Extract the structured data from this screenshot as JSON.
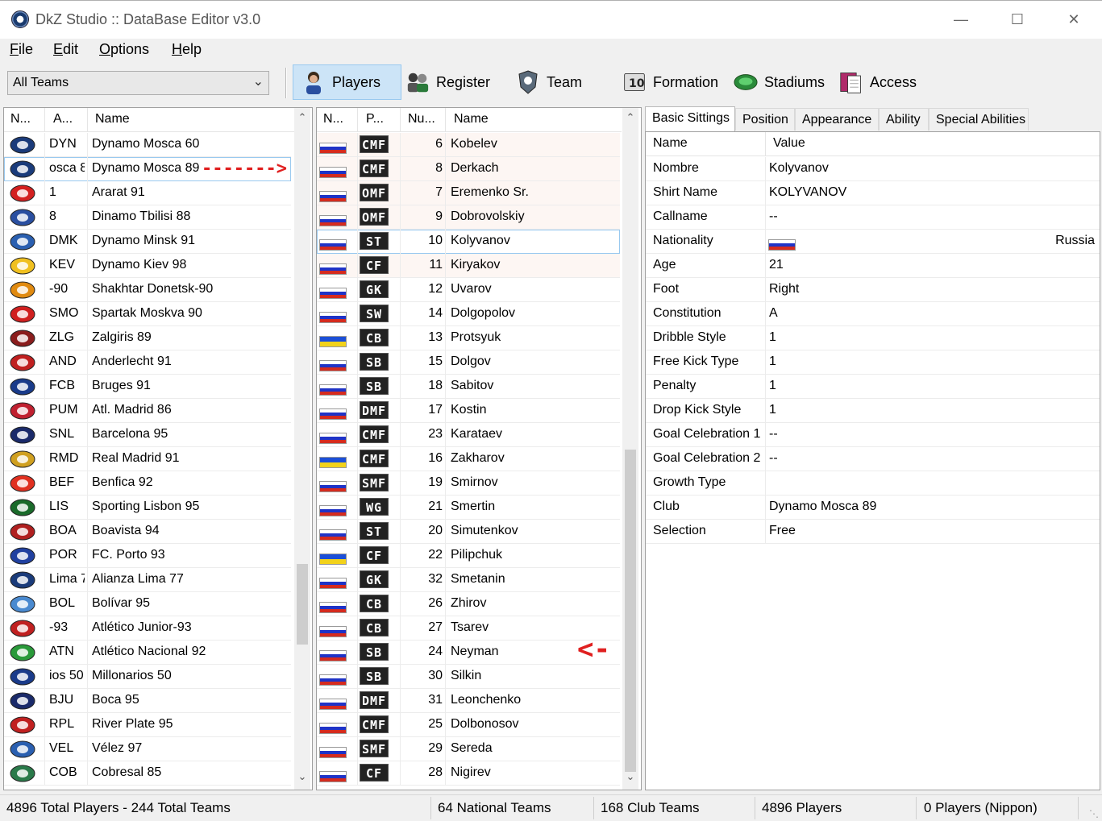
{
  "window": {
    "title": "DkZ Studio :: DataBase Editor v3.0",
    "minimize": "—",
    "maximize": "☐",
    "close": "✕"
  },
  "menu": [
    {
      "key": "F",
      "rest": "ile"
    },
    {
      "key": "E",
      "rest": "dit"
    },
    {
      "key": "O",
      "rest": "ptions"
    },
    {
      "key": "H",
      "rest": "elp"
    }
  ],
  "toolbar": {
    "team_filter": "All Teams",
    "buttons": [
      {
        "label": "Players",
        "icon": "player-icon",
        "active": true
      },
      {
        "label": "Register",
        "icon": "register-icon"
      },
      {
        "label": "Team",
        "icon": "team-icon"
      },
      {
        "label": "Formation",
        "icon": "formation-icon"
      },
      {
        "label": "Stadiums",
        "icon": "stadium-icon"
      },
      {
        "label": "Access",
        "icon": "access-icon"
      }
    ]
  },
  "teams": {
    "headers": [
      "N...",
      "A...",
      "Name"
    ],
    "selected_index": 1,
    "rows": [
      {
        "abbr": "DYN",
        "name": "Dynamo Mosca 60",
        "logo": "#1a3b7a"
      },
      {
        "abbr": "osca 8",
        "name": "Dynamo Mosca 89",
        "logo": "#1a3b7a"
      },
      {
        "abbr": "1",
        "name": "Ararat 91",
        "logo": "#d32020"
      },
      {
        "abbr": "8",
        "name": "Dinamo Tbilisi 88",
        "logo": "#2a4fa0"
      },
      {
        "abbr": "DMK",
        "name": "Dynamo Minsk 91",
        "logo": "#2a5fb0"
      },
      {
        "abbr": "KEV",
        "name": "Dynamo Kiev 98",
        "logo": "#f0c020"
      },
      {
        "abbr": "-90",
        "name": "Shakhtar Donetsk-90",
        "logo": "#e08a10"
      },
      {
        "abbr": "SMO",
        "name": "Spartak Moskva 90",
        "logo": "#d02020"
      },
      {
        "abbr": "ZLG",
        "name": "Zalgiris 89",
        "logo": "#8a1d1d"
      },
      {
        "abbr": "AND",
        "name": "Anderlecht 91",
        "logo": "#c02020"
      },
      {
        "abbr": "FCB",
        "name": "Bruges 91",
        "logo": "#1a3b8a"
      },
      {
        "abbr": "PUM",
        "name": "Atl. Madrid 86",
        "logo": "#c02030"
      },
      {
        "abbr": "SNL",
        "name": "Barcelona 95",
        "logo": "#1a2a6a"
      },
      {
        "abbr": "RMD",
        "name": "Real Madrid 91",
        "logo": "#d0a020"
      },
      {
        "abbr": "BEF",
        "name": "Benfica 92",
        "logo": "#e03020"
      },
      {
        "abbr": "LIS",
        "name": "Sporting Lisbon 95",
        "logo": "#1a6a2a"
      },
      {
        "abbr": "BOA",
        "name": "Boavista 94",
        "logo": "#b02020"
      },
      {
        "abbr": "POR",
        "name": "FC. Porto 93",
        "logo": "#2040a0"
      },
      {
        "abbr": "Lima 7",
        "name": "Alianza Lima 77",
        "logo": "#1a3b7a"
      },
      {
        "abbr": "BOL",
        "name": "Bolívar 95",
        "logo": "#4a8ad0"
      },
      {
        "abbr": "-93",
        "name": "Atlético Junior-93",
        "logo": "#c02020"
      },
      {
        "abbr": "ATN",
        "name": "Atlético Nacional 92",
        "logo": "#2a9a3a"
      },
      {
        "abbr": "ios 50",
        "name": "Millonarios 50",
        "logo": "#1a3b8a"
      },
      {
        "abbr": "BJU",
        "name": "Boca 95",
        "logo": "#1a2a6a"
      },
      {
        "abbr": "RPL",
        "name": "River Plate 95",
        "logo": "#c02020"
      },
      {
        "abbr": "VEL",
        "name": "Vélez 97",
        "logo": "#2a5fb0"
      },
      {
        "abbr": "COB",
        "name": "Cobresal 85",
        "logo": "#2a7a4a"
      }
    ]
  },
  "players": {
    "headers": [
      "N...",
      "P...",
      "Nu...",
      "Name"
    ],
    "selected_index": 4,
    "rows": [
      {
        "flag": "ru",
        "pos": "CMF",
        "num": "6",
        "name": "Kobelev"
      },
      {
        "flag": "ru",
        "pos": "CMF",
        "num": "8",
        "name": "Derkach"
      },
      {
        "flag": "ru",
        "pos": "OMF",
        "num": "7",
        "name": "Eremenko Sr."
      },
      {
        "flag": "ru",
        "pos": "OMF",
        "num": "9",
        "name": "Dobrovolskiy"
      },
      {
        "flag": "ru",
        "pos": "ST",
        "num": "10",
        "name": "Kolyvanov"
      },
      {
        "flag": "ru",
        "pos": "CF",
        "num": "11",
        "name": "Kiryakov"
      },
      {
        "flag": "ru",
        "pos": "GK",
        "num": "12",
        "name": "Uvarov"
      },
      {
        "flag": "ru",
        "pos": "SW",
        "num": "14",
        "name": "Dolgopolov"
      },
      {
        "flag": "ua",
        "pos": "CB",
        "num": "13",
        "name": "Protsyuk"
      },
      {
        "flag": "ru",
        "pos": "SB",
        "num": "15",
        "name": "Dolgov"
      },
      {
        "flag": "ru",
        "pos": "SB",
        "num": "18",
        "name": "Sabitov"
      },
      {
        "flag": "ru",
        "pos": "DMF",
        "num": "17",
        "name": "Kostin"
      },
      {
        "flag": "ru",
        "pos": "CMF",
        "num": "23",
        "name": "Karataev"
      },
      {
        "flag": "ua",
        "pos": "CMF",
        "num": "16",
        "name": "Zakharov"
      },
      {
        "flag": "ru",
        "pos": "SMF",
        "num": "19",
        "name": "Smirnov"
      },
      {
        "flag": "ru",
        "pos": "WG",
        "num": "21",
        "name": "Smertin"
      },
      {
        "flag": "ru",
        "pos": "ST",
        "num": "20",
        "name": "Simutenkov"
      },
      {
        "flag": "ua",
        "pos": "CF",
        "num": "22",
        "name": "Pilipchuk"
      },
      {
        "flag": "ru",
        "pos": "GK",
        "num": "32",
        "name": "Smetanin"
      },
      {
        "flag": "ru",
        "pos": "CB",
        "num": "26",
        "name": "Zhirov"
      },
      {
        "flag": "ru",
        "pos": "CB",
        "num": "27",
        "name": "Tsarev"
      },
      {
        "flag": "ru",
        "pos": "SB",
        "num": "24",
        "name": "Neyman"
      },
      {
        "flag": "ru",
        "pos": "SB",
        "num": "30",
        "name": "Silkin"
      },
      {
        "flag": "ru",
        "pos": "DMF",
        "num": "31",
        "name": "Leonchenko"
      },
      {
        "flag": "ru",
        "pos": "CMF",
        "num": "25",
        "name": "Dolbonosov"
      },
      {
        "flag": "ru",
        "pos": "SMF",
        "num": "29",
        "name": "Sereda"
      },
      {
        "flag": "ru",
        "pos": "CF",
        "num": "28",
        "name": "Nigirev"
      }
    ]
  },
  "details": {
    "tabs": [
      "Basic Sittings",
      "Position",
      "Appearance",
      "Ability",
      "Special Abilities"
    ],
    "active_tab": 0,
    "headers": [
      "Name",
      "Value"
    ],
    "rows": [
      {
        "label": "Nombre",
        "value": "Kolyvanov"
      },
      {
        "label": "Shirt Name",
        "value": "KOLYVANOV"
      },
      {
        "label": "Callname",
        "value": "--"
      },
      {
        "label": "Nationality",
        "value": "",
        "flag": "ru",
        "extra": "Russia"
      },
      {
        "label": "Age",
        "value": "21"
      },
      {
        "label": "Foot",
        "value": "Right"
      },
      {
        "label": "Constitution",
        "value": "A"
      },
      {
        "label": "Dribble Style",
        "value": "1"
      },
      {
        "label": "Free Kick Type",
        "value": "1"
      },
      {
        "label": "Penalty",
        "value": "1"
      },
      {
        "label": "Drop Kick Style",
        "value": "1"
      },
      {
        "label": "Goal Celebration 1",
        "value": "--"
      },
      {
        "label": "Goal Celebration 2",
        "value": "--"
      },
      {
        "label": "Growth Type",
        "value": ""
      },
      {
        "label": "Club",
        "value": "Dynamo Mosca 89"
      },
      {
        "label": "Selection",
        "value": "Free"
      }
    ]
  },
  "annotations": {
    "arrow_right": "------->",
    "arrow_left": "<-"
  },
  "status": {
    "totals": "4896 Total Players  -  244 Total Teams",
    "national": "64 National Teams",
    "club": "168 Club Teams",
    "players": "4896 Players",
    "nippon": "0 Players (Nippon)"
  },
  "colors": {
    "selected_row": "#cce4f7",
    "accent_arrow": "#e02020",
    "flag_ru": [
      "#ffffff",
      "#1f33c7",
      "#d52b1e"
    ],
    "flag_ua": [
      "#1c4fd7",
      "#f2d21a"
    ]
  }
}
